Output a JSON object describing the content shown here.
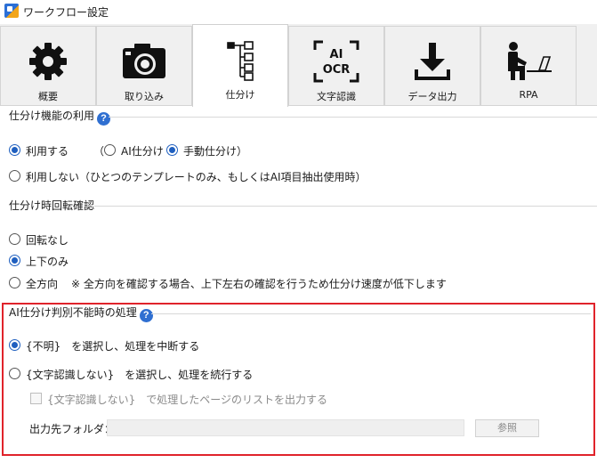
{
  "window": {
    "title": "ワークフロー設定",
    "app_icon": "app-logo-icon"
  },
  "tabs": [
    {
      "label": "概要",
      "icon": "gear-icon",
      "active": false
    },
    {
      "label": "取り込み",
      "icon": "camera-icon",
      "active": false
    },
    {
      "label": "仕分け",
      "icon": "tree-sort-icon",
      "active": true
    },
    {
      "label": "文字認識",
      "icon": "ai-ocr-icon",
      "active": false
    },
    {
      "label": "データ出力",
      "icon": "download-icon",
      "active": false
    },
    {
      "label": "RPA",
      "icon": "person-at-computer-icon",
      "active": false
    }
  ],
  "ai_ocr_icon_text": {
    "line1": "AI",
    "line2": "OCR"
  },
  "sorting": {
    "title": "仕分け機能の利用",
    "use_label": "利用する",
    "paren_open": "（",
    "ai_label": "AI仕分け",
    "manual_label": "手動仕分け",
    "paren_close": "）",
    "not_use_label": "利用しない（ひとつのテンプレートのみ、もしくはAI項目抽出使用時）",
    "selected": "use",
    "mode": "manual"
  },
  "rotation": {
    "title": "仕分け時回転確認",
    "none_label": "回転なし",
    "updown_label": "上下のみ",
    "all_label": "全方向",
    "all_note": "※ 全方向を確認する場合、上下左右の確認を行うため仕分け速度が低下します",
    "selected": "updown"
  },
  "ai_fail": {
    "title": "AI仕分け判別不能時の処理",
    "opt1_label": "{不明}　を選択し、処理を中断する",
    "opt2_label": "{文字認識しない}　を選択し、処理を続行する",
    "checkbox_label": "{文字認識しない}　で処理したページのリストを出力する",
    "folder_label": "出力先フォルダ：",
    "folder_value": "",
    "browse_label": "参照",
    "selected": "opt1"
  },
  "colors": {
    "accent": "#1f5fbf",
    "highlight_frame": "#e0232b",
    "help_badge": "#2f6fd1"
  }
}
